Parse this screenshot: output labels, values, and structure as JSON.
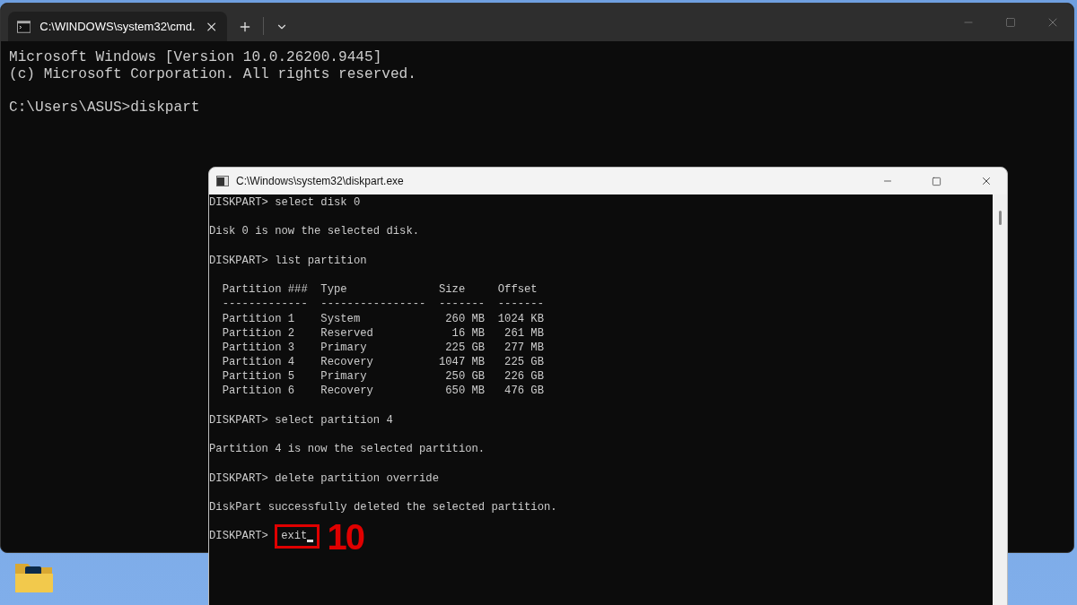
{
  "terminal": {
    "tab": {
      "title": "C:\\WINDOWS\\system32\\cmd."
    },
    "lines": [
      {
        "kind": "text",
        "text": "Microsoft Windows [Version 10.0.26200.9445]"
      },
      {
        "kind": "text",
        "text": "(c) Microsoft Corporation. All rights reserved."
      },
      {
        "kind": "blank"
      },
      {
        "kind": "text",
        "text": "C:\\Users\\ASUS>diskpart"
      }
    ]
  },
  "diskpart_window": {
    "title": "C:\\Windows\\system32\\diskpart.exe",
    "lines": [
      {
        "kind": "text",
        "text": "DISKPART> select disk 0"
      },
      {
        "kind": "blank"
      },
      {
        "kind": "text",
        "text": "Disk 0 is now the selected disk."
      },
      {
        "kind": "blank"
      },
      {
        "kind": "text",
        "text": "DISKPART> list partition"
      },
      {
        "kind": "blank"
      },
      {
        "kind": "table",
        "columns": [
          "Partition ###",
          "Type",
          "Size",
          "Offset"
        ],
        "separators": [
          "-------------",
          "----------------",
          "-------",
          "-------"
        ],
        "rows": [
          [
            "Partition 1",
            "System",
            "260 MB",
            "1024 KB"
          ],
          [
            "Partition 2",
            "Reserved",
            "16 MB",
            "261 MB"
          ],
          [
            "Partition 3",
            "Primary",
            "225 GB",
            "277 MB"
          ],
          [
            "Partition 4",
            "Recovery",
            "1047 MB",
            "225 GB"
          ],
          [
            "Partition 5",
            "Primary",
            "250 GB",
            "226 GB"
          ],
          [
            "Partition 6",
            "Recovery",
            "650 MB",
            "476 GB"
          ]
        ]
      },
      {
        "kind": "blank"
      },
      {
        "kind": "text",
        "text": "DISKPART> select partition 4"
      },
      {
        "kind": "blank"
      },
      {
        "kind": "text",
        "text": "Partition 4 is now the selected partition."
      },
      {
        "kind": "blank"
      },
      {
        "kind": "text",
        "text": "DISKPART> delete partition override"
      },
      {
        "kind": "blank"
      },
      {
        "kind": "text",
        "text": "DiskPart successfully deleted the selected partition."
      },
      {
        "kind": "blank"
      },
      {
        "kind": "prompt",
        "prompt": "DISKPART>",
        "input": "exit",
        "cursor": true,
        "annotation": "10"
      }
    ]
  }
}
